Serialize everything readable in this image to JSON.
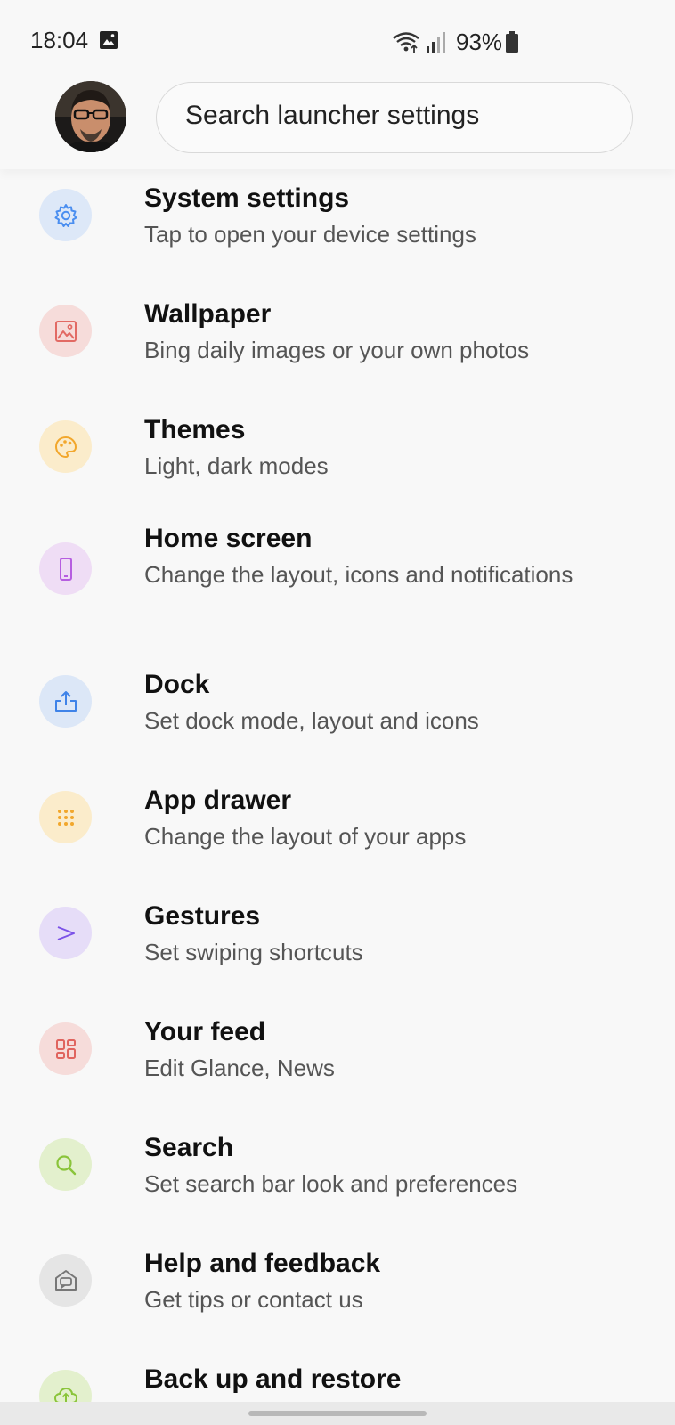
{
  "status_bar": {
    "time": "18:04",
    "battery": "93%",
    "icons": [
      "gallery-icon",
      "wifi-icon",
      "signal-icon",
      "battery-icon"
    ]
  },
  "header": {
    "search_placeholder": "Search launcher settings",
    "avatar": "user-avatar"
  },
  "settings": [
    {
      "title": "System settings",
      "subtitle": "Tap to open your device settings",
      "icon": "gear-icon",
      "color": "#4a8ef0",
      "bg": "#dde8f8"
    },
    {
      "title": "Wallpaper",
      "subtitle": "Bing daily images or your own photos",
      "icon": "image-icon",
      "color": "#e26a64",
      "bg": "#f6dcda"
    },
    {
      "title": "Themes",
      "subtitle": "Light, dark modes",
      "icon": "palette-icon",
      "color": "#f2a72c",
      "bg": "#fbeccb"
    },
    {
      "title": "Home screen",
      "subtitle": "Change the layout, icons and notifications",
      "icon": "phone-icon",
      "color": "#b65ee0",
      "bg": "#efddf5"
    },
    {
      "title": "Dock",
      "subtitle": "Set dock mode, layout and icons",
      "icon": "dock-upload-icon",
      "color": "#3f83e8",
      "bg": "#dce7f7"
    },
    {
      "title": "App drawer",
      "subtitle": "Change the layout of your apps",
      "icon": "grid-dots-icon",
      "color": "#f2a72c",
      "bg": "#fbeccb"
    },
    {
      "title": "Gestures",
      "subtitle": "Set swiping shortcuts",
      "icon": "gesture-icon",
      "color": "#7b52e8",
      "bg": "#e6ddf8"
    },
    {
      "title": "Your feed",
      "subtitle": "Edit Glance, News",
      "icon": "feed-icon",
      "color": "#e0645e",
      "bg": "#f6dcda"
    },
    {
      "title": "Search",
      "subtitle": "Set search bar look and preferences",
      "icon": "search-icon",
      "color": "#8ac43a",
      "bg": "#e3f0cd"
    },
    {
      "title": "Help and feedback",
      "subtitle": "Get tips or contact us",
      "icon": "help-icon",
      "color": "#777777",
      "bg": "#e5e5e5"
    },
    {
      "title": "Back up and restore",
      "subtitle": "",
      "icon": "backup-icon",
      "color": "#8ac43a",
      "bg": "#e3f0cd"
    }
  ]
}
